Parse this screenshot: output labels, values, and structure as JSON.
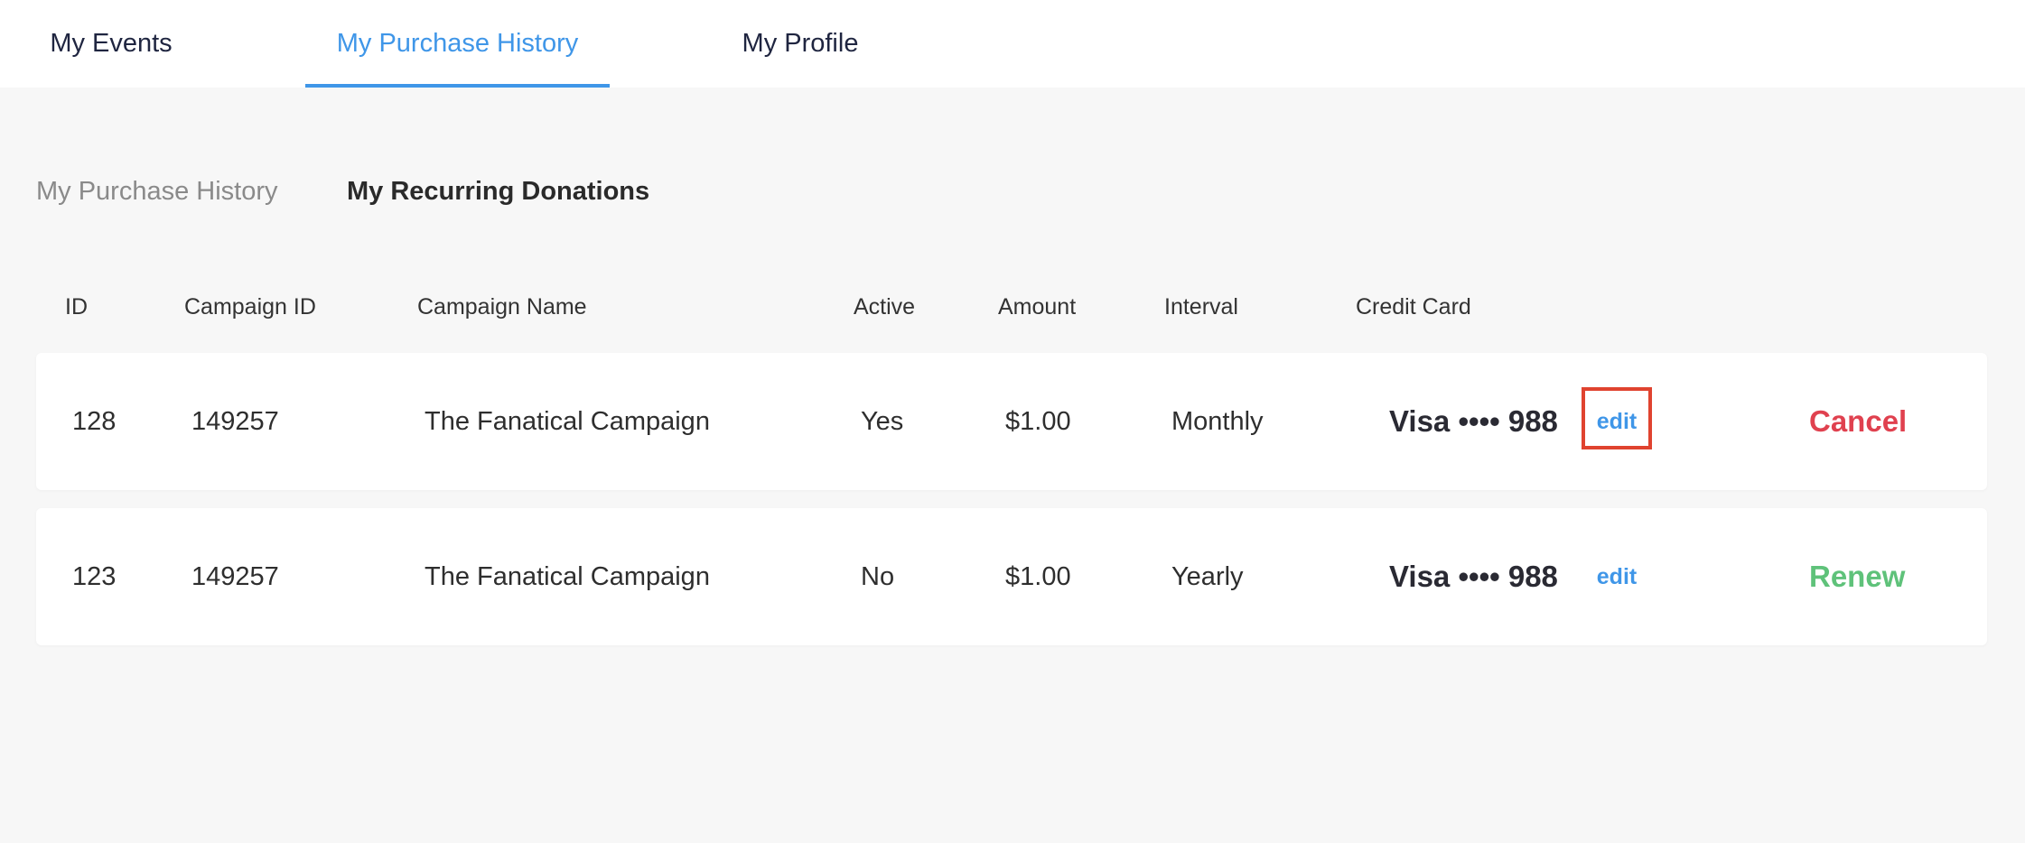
{
  "top_nav": {
    "tabs": [
      {
        "label": "My Events"
      },
      {
        "label": "My Purchase History"
      },
      {
        "label": "My Profile"
      }
    ],
    "active": "My Purchase History"
  },
  "sub_tabs": [
    {
      "label": "My Purchase History"
    },
    {
      "label": "My Recurring Donations"
    }
  ],
  "table": {
    "columns": [
      "ID",
      "Campaign ID",
      "Campaign Name",
      "Active",
      "Amount",
      "Interval",
      "Credit Card"
    ],
    "rows": [
      {
        "id": "128",
        "campaign_id": "149257",
        "campaign_name": "The Fanatical Campaign",
        "active": "Yes",
        "amount": "$1.00",
        "interval": "Monthly",
        "card": "Visa •••• 988",
        "edit": "edit",
        "action": "Cancel"
      },
      {
        "id": "123",
        "campaign_id": "149257",
        "campaign_name": "The Fanatical Campaign",
        "active": "No",
        "amount": "$1.00",
        "interval": "Yearly",
        "card": "Visa •••• 988",
        "edit": "edit",
        "action": "Renew"
      }
    ]
  },
  "colors": {
    "accent": "#3f96e8",
    "cancel": "#e0414f",
    "renew": "#5fc27a",
    "highlight": "#e0432f"
  }
}
